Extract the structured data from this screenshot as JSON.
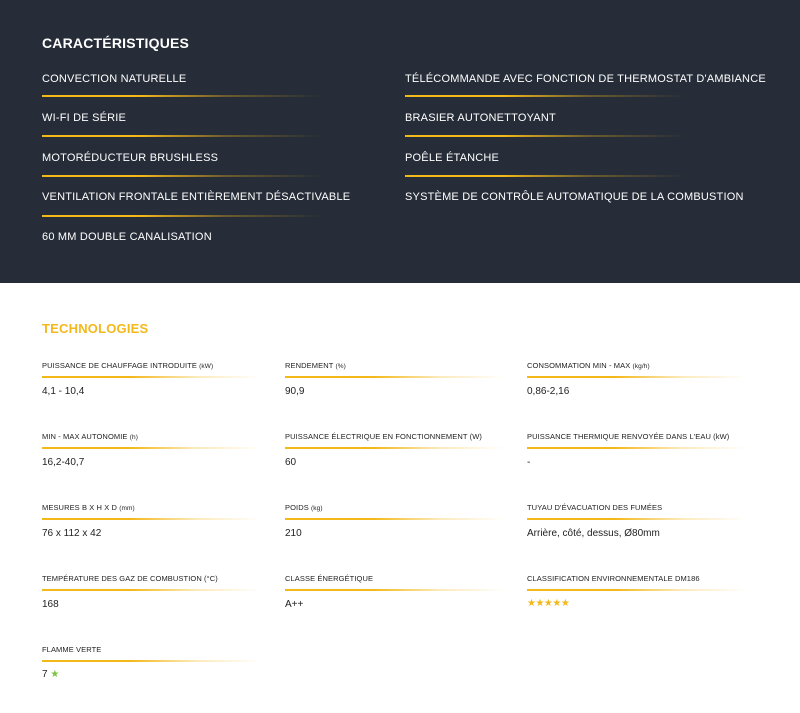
{
  "caracteristiques": {
    "title": "CARACTÉRISTIQUES",
    "features_left": [
      "CONVECTION NATURELLE",
      "WI-FI DE SÉRIE",
      "MOTORÉDUCTEUR BRUSHLESS",
      "VENTILATION FRONTALE ENTIÈREMENT DÉSACTIVABLE",
      "60 MM DOUBLE CANALISATION"
    ],
    "features_right": [
      "TÉLÉCOMMANDE AVEC FONCTION DE THERMOSTAT D'AMBIANCE",
      "BRASIER AUTONETTOYANT",
      "POÊLE ÉTANCHE",
      "SYSTÈME DE CONTRÔLE AUTOMATIQUE DE LA COMBUSTION"
    ]
  },
  "technologies": {
    "title": "TECHNOLOGIES",
    "specs": [
      {
        "label": "PUISSANCE DE CHAUFFAGE INTRODUITE",
        "unit": "(kW)",
        "value": "4,1 - 10,4"
      },
      {
        "label": "RENDEMENT",
        "unit": "(%)",
        "value": "90,9"
      },
      {
        "label": "CONSOMMATION MIN - MAX",
        "unit": "(kg/h)",
        "value": "0,86-2,16"
      },
      {
        "label": "MIN - MAX AUTONOMIE",
        "unit": "(h)",
        "value": "16,2-40,7"
      },
      {
        "label": "PUISSANCE ÉLECTRIQUE EN FONCTIONNEMENT (W)",
        "unit": "",
        "value": "60"
      },
      {
        "label": "PUISSANCE THERMIQUE RENVOYÉE DANS L'EAU (kW)",
        "unit": "",
        "value": "-"
      },
      {
        "label": "MESURES B X H X D",
        "unit": "(mm)",
        "value": "76 x 112 x 42"
      },
      {
        "label": "POIDS",
        "unit": "(kg)",
        "value": "210"
      },
      {
        "label": "TUYAU D'ÉVACUATION DES FUMÉES",
        "unit": "",
        "value": "Arrière, côté, dessus, Ø80mm"
      },
      {
        "label": "TEMPÉRATURE DES GAZ DE COMBUSTION (°C)",
        "unit": "",
        "value": "168"
      },
      {
        "label": "CLASSE ÉNERGÉTIQUE",
        "unit": "",
        "value": "A++"
      },
      {
        "label": "CLASSIFICATION ENVIRONNEMENTALE DM186",
        "unit": "",
        "rating_stars": 5,
        "stars_text": "★★★★★"
      },
      {
        "label": "FLAMME VERTE",
        "unit": "",
        "value": "7",
        "star_text": "★"
      }
    ]
  },
  "colors": {
    "dark_bg": "#262d38",
    "accent": "#f3b81a",
    "green_star": "#7cc242"
  }
}
